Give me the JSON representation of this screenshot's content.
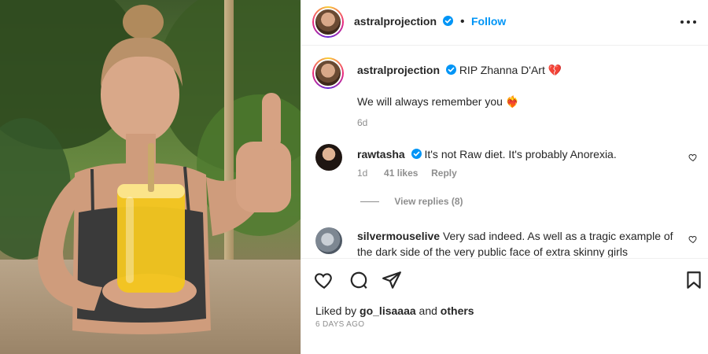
{
  "post": {
    "author": "astralprojection",
    "follow_label": "Follow",
    "verified": true
  },
  "caption": {
    "username": "astralprojection",
    "text": "RIP Zhanna D'Art",
    "text_emoji": "💔",
    "line2": "We will always remember you",
    "line2_emoji": "❤️‍🔥",
    "time": "6d"
  },
  "comments": [
    {
      "username": "rawtasha",
      "verified": true,
      "text": "It's not Raw diet. It's probably Anorexia.",
      "time": "1d",
      "likes": "41 likes",
      "reply_label": "Reply",
      "view_replies": "View replies (8)"
    },
    {
      "username": "silvermouselive",
      "verified": false,
      "text": "Very sad indeed. As well as a tragic example of the dark side of the very public face of extra skinny girls"
    }
  ],
  "footer": {
    "liked_by_prefix": "Liked by",
    "liked_by_user": "go_lisaaaa",
    "liked_by_and": "and",
    "liked_by_others": "others",
    "date": "6 DAYS AGO"
  },
  "colors": {
    "accent": "#0095f6",
    "verified": "#0095f6",
    "text": "#262626",
    "secondary": "#8e8e8e",
    "heart_emoji": "#e0245e"
  },
  "icons": {
    "like": "heart-outline-icon",
    "comment": "speech-bubble-icon",
    "share": "paper-plane-icon",
    "save": "bookmark-icon",
    "more": "more-horizontal-icon",
    "verified": "verified-badge-icon"
  }
}
